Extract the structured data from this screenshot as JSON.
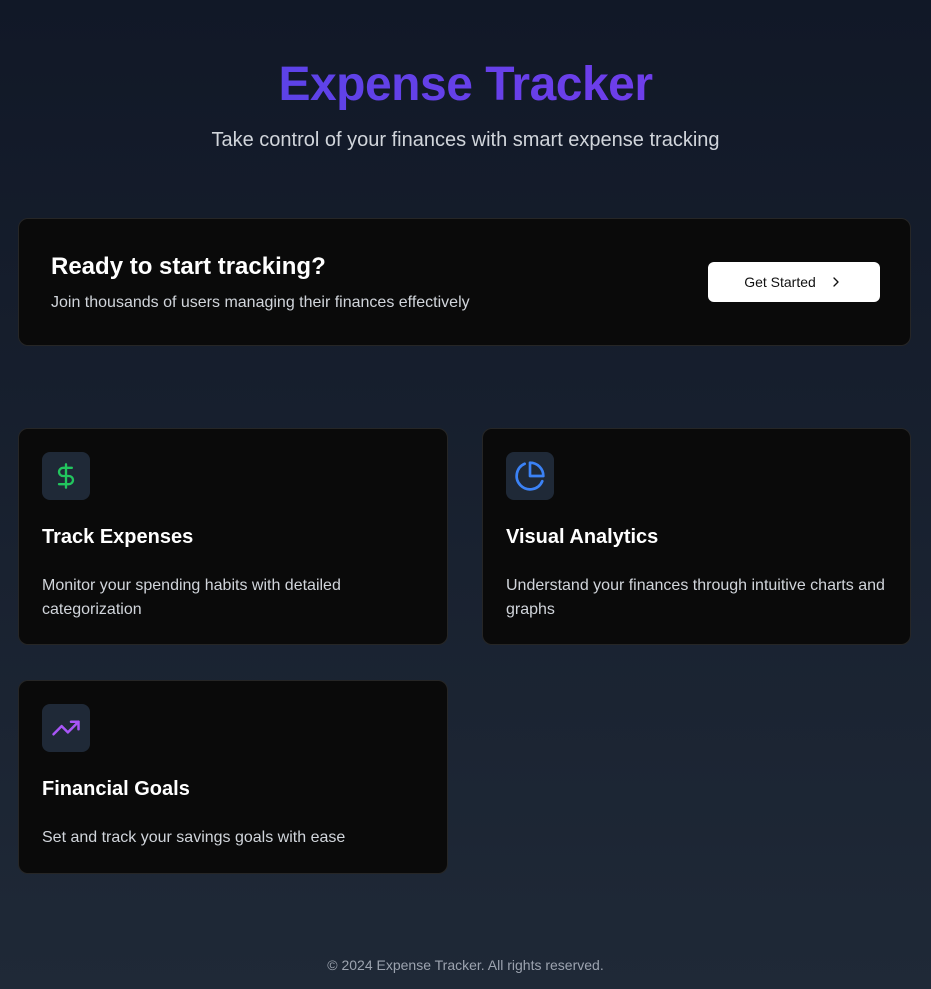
{
  "hero": {
    "title": "Expense Tracker",
    "subtitle": "Take control of your finances with smart expense tracking",
    "gradient_start": "#4f46e5",
    "gradient_end": "#7c3aed"
  },
  "cta": {
    "title": "Ready to start tracking?",
    "description": "Join thousands of users managing their finances effectively",
    "button_label": "Get Started",
    "button_icon": "chevron-right-icon"
  },
  "features": [
    {
      "title": "Track Expenses",
      "description": "Monitor your spending habits with detailed categorization",
      "icon": "dollar-sign-icon",
      "icon_color": "#22c55e"
    },
    {
      "title": "Visual Analytics",
      "description": "Understand your finances through intuitive charts and graphs",
      "icon": "pie-chart-icon",
      "icon_color": "#3b82f6"
    },
    {
      "title": "Financial Goals",
      "description": "Set and track your savings goals with ease",
      "icon": "trending-up-icon",
      "icon_color": "#a855f7"
    }
  ],
  "footer": {
    "text": "© 2024 Expense Tracker. All rights reserved."
  },
  "colors": {
    "background_top": "#111827",
    "background_bottom": "#1f2937",
    "card_background": "#0a0a0a",
    "text_muted": "#d1d5db"
  }
}
